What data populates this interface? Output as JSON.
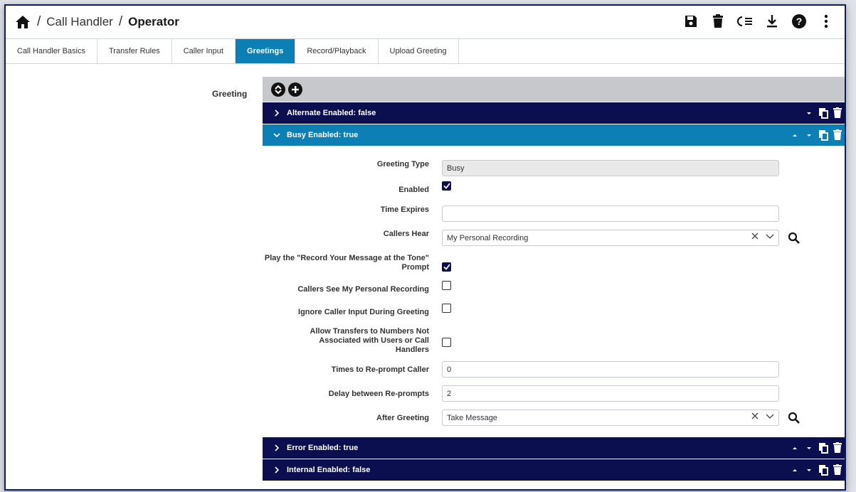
{
  "breadcrumb": {
    "sep": "/",
    "parent": "Call Handler",
    "current": "Operator"
  },
  "toolbar": {
    "icons": [
      "save-icon",
      "trash-icon",
      "bulk-edit-icon",
      "download-icon",
      "help-icon",
      "more-vertical-icon"
    ]
  },
  "tabs": [
    {
      "label": "Call Handler Basics"
    },
    {
      "label": "Transfer Rules"
    },
    {
      "label": "Caller Input"
    },
    {
      "label": "Greetings",
      "active": true
    },
    {
      "label": "Record/Playback"
    },
    {
      "label": "Upload Greeting"
    }
  ],
  "greeting_label": "Greeting",
  "accordion": [
    {
      "title": "Alternate Enabled: false",
      "expanded": false
    },
    {
      "title": "Busy Enabled: true",
      "expanded": true
    },
    {
      "title": "Error Enabled: true",
      "expanded": false
    },
    {
      "title": "Internal Enabled: false",
      "expanded": false
    }
  ],
  "form": {
    "greeting_type": {
      "label": "Greeting Type",
      "value": "Busy"
    },
    "enabled": {
      "label": "Enabled",
      "checked": true
    },
    "time_expires": {
      "label": "Time Expires",
      "value": ""
    },
    "callers_hear": {
      "label": "Callers Hear",
      "value": "My Personal Recording"
    },
    "play_record_prompt": {
      "label": "Play the \"Record Your Message at the Tone\" Prompt",
      "checked": true
    },
    "callers_see_recording": {
      "label": "Callers See My Personal Recording",
      "checked": false
    },
    "ignore_caller_input": {
      "label": "Ignore Caller Input During Greeting",
      "checked": false
    },
    "allow_transfers": {
      "label": "Allow Transfers to Numbers Not Associated with Users or Call Handlers",
      "checked": false
    },
    "times_reprompt": {
      "label": "Times to Re-prompt Caller",
      "value": "0"
    },
    "delay_reprompts": {
      "label": "Delay between Re-prompts",
      "value": "2"
    },
    "after_greeting": {
      "label": "After Greeting",
      "value": "Take Message"
    }
  },
  "colors": {
    "accent": "#0c7fb5",
    "navy": "#0b0f4f",
    "toolbar_gray": "#c6c8cb"
  }
}
